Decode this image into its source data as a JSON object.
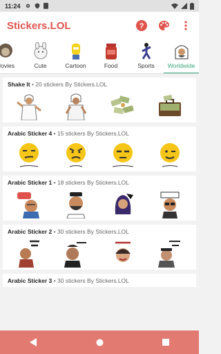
{
  "status": {
    "time": "11:24"
  },
  "appbar": {
    "title": "Stickers.LOL"
  },
  "categories": [
    {
      "label": "Movies"
    },
    {
      "label": "Cute"
    },
    {
      "label": "Cartoon"
    },
    {
      "label": "Food"
    },
    {
      "label": "Sports"
    },
    {
      "label": "Worldwide"
    }
  ],
  "packs": [
    {
      "name": "Shake It",
      "meta": " • 20 stickers By Stickers.LOL"
    },
    {
      "name": "Arabic Sticker 4",
      "meta": " • 15 stickers By Stickers.LOL"
    },
    {
      "name": "Arabic Sticker 1",
      "meta": " • 18 stickers By Stickers.LOL"
    },
    {
      "name": "Arabic Sticker 2",
      "meta": " • 30 stickers By Stickers.LOL"
    },
    {
      "name": "Arabic Sticker 3",
      "meta": " • 30 stickers By Stickers.LOL"
    }
  ],
  "colors": {
    "accent": "#e0534d",
    "active_tab": "#35a57a",
    "navbar": "#e27a72"
  }
}
